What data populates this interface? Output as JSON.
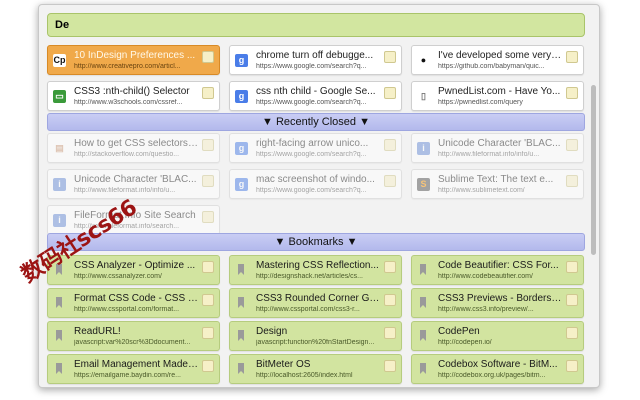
{
  "search": {
    "value": "De"
  },
  "open_tabs": [
    {
      "title": "10 InDesign Preferences ...",
      "url": "http://www.creativepro.com/articl...",
      "icon": "creativepro-icon",
      "selected": true
    },
    {
      "title": "chrome turn off debugge...",
      "url": "https://www.google.com/search?q...",
      "icon": "google-icon"
    },
    {
      "title": "I've developed some very ...",
      "url": "https://github.com/babyman/quic...",
      "icon": "github-icon"
    },
    {
      "title": "CSS3 :nth-child() Selector",
      "url": "http://www.w3schools.com/cssref...",
      "icon": "w3schools-icon"
    },
    {
      "title": "css nth child - Google Se...",
      "url": "https://www.google.com/search?q...",
      "icon": "google-icon"
    },
    {
      "title": "PwnedList.com - Have Yo...",
      "url": "https://pwnedlist.com/query",
      "icon": "page-icon"
    }
  ],
  "recently_closed": {
    "label": "▼ Recently Closed ▼",
    "items": [
      {
        "title": "How to get CSS selectors ...",
        "url": "http://stackoverflow.com/questio...",
        "icon": "stackoverflow-icon"
      },
      {
        "title": "right-facing arrow unico...",
        "url": "https://www.google.com/search?q...",
        "icon": "google-icon"
      },
      {
        "title": "Unicode Character 'BLAC...",
        "url": "http://www.fileformat.info/info/u...",
        "icon": "info-icon"
      },
      {
        "title": "Unicode Character 'BLAC...",
        "url": "http://www.fileformat.info/info/u...",
        "icon": "info-icon"
      },
      {
        "title": "mac screenshot of windo...",
        "url": "https://www.google.com/search?q...",
        "icon": "google-icon"
      },
      {
        "title": "Sublime Text: The text e...",
        "url": "http://www.sublimetext.com/",
        "icon": "sublime-icon"
      },
      {
        "title": "FileFormat.Info Site Search",
        "url": "http://www.fileformat.info/search...",
        "icon": "info-icon"
      }
    ]
  },
  "bookmarks": {
    "label": "▼ Bookmarks ▼",
    "items": [
      {
        "title": "CSS Analyzer - Optimize ...",
        "url": "http://www.cssanalyzer.com/"
      },
      {
        "title": "Mastering CSS Reflection...",
        "url": "http://designshack.net/articles/cs..."
      },
      {
        "title": "Code Beautifier: CSS For...",
        "url": "http://www.codebeautifier.com/"
      },
      {
        "title": "Format CSS Code - CSS P...",
        "url": "http://www.cssportal.com/format..."
      },
      {
        "title": "CSS3 Rounded Corner Ge...",
        "url": "http://www.cssportal.com/css3-r..."
      },
      {
        "title": "CSS3 Previews - Borders ...",
        "url": "http://www.css3.info/preview/..."
      },
      {
        "title": "ReadURL!",
        "url": "javascript:var%20scr%3Ddocument..."
      },
      {
        "title": "Design",
        "url": "javascript:function%20fnStartDesign..."
      },
      {
        "title": "CodePen",
        "url": "http://codepen.io/"
      },
      {
        "title": "Email Management Made ...",
        "url": "https://emailgame.baydin.com/re..."
      },
      {
        "title": "BitMeter OS",
        "url": "http://localhost:2605/index.html"
      },
      {
        "title": "Codebox Software - BitM...",
        "url": "http://codebox.org.uk/pages/bitm..."
      }
    ]
  },
  "watermark": "数码社scs66",
  "colors": {
    "selected": "#f0a94a",
    "search_bg": "#d2e6a0",
    "bookmark_bg": "#d2e4a0",
    "section_header": "#b3b9ec"
  }
}
